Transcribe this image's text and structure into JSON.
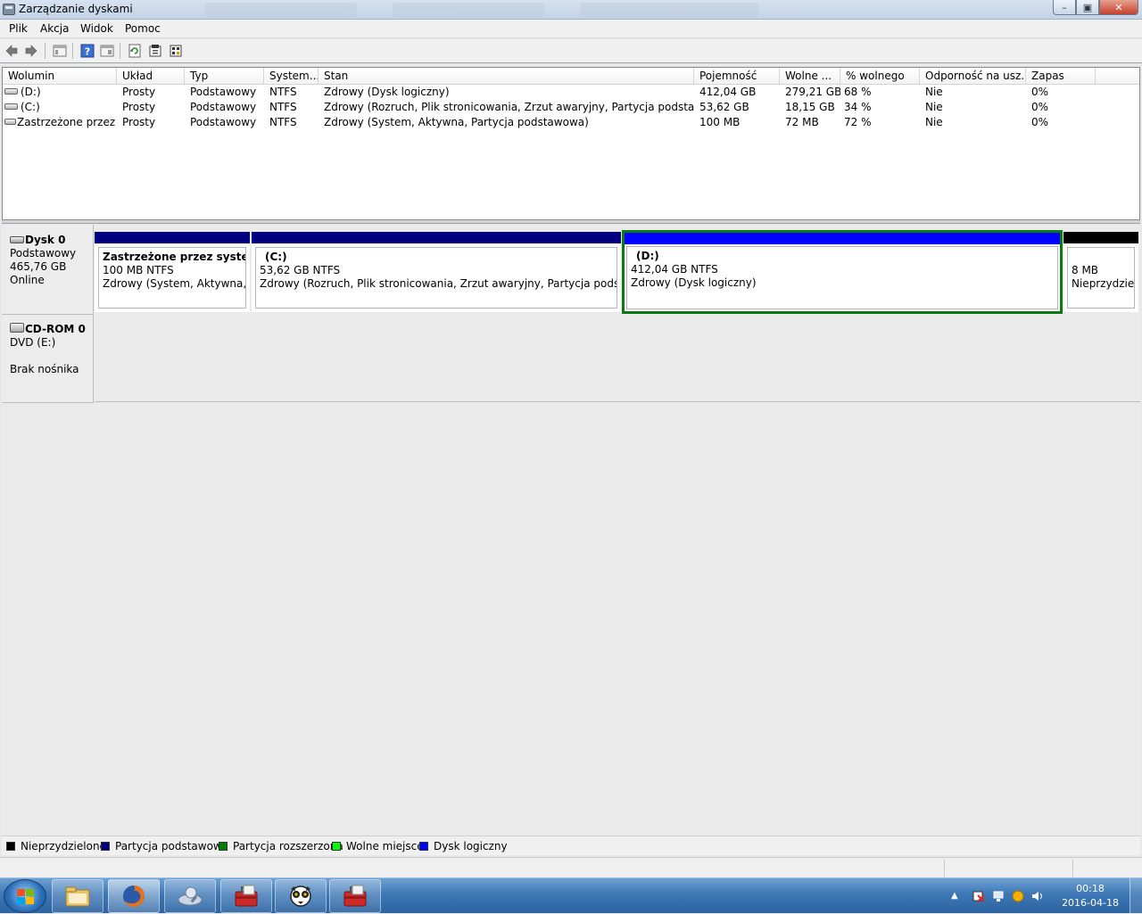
{
  "window": {
    "title": "Zarządzanie dyskami"
  },
  "menu": [
    "Plik",
    "Akcja",
    "Widok",
    "Pomoc"
  ],
  "toolbar": {
    "icons": [
      "back-arrow-icon",
      "forward-arrow-icon",
      "console-tree-icon",
      "help-icon",
      "properties-icon",
      "refresh-icon",
      "rescan-icon",
      "export-list-icon"
    ]
  },
  "volume_list": {
    "columns": [
      "Wolumin",
      "Układ",
      "Typ",
      "System...",
      "Stan",
      "Pojemność",
      "Wolne ...",
      "% wolnego",
      "Odporność na usz...",
      "Zapas"
    ],
    "rows": [
      [
        "(D:)",
        "Prosty",
        "Podstawowy",
        "NTFS",
        "Zdrowy (Dysk logiczny)",
        "412,04 GB",
        "279,21 GB",
        "68 %",
        "Nie",
        "0%"
      ],
      [
        "(C:)",
        "Prosty",
        "Podstawowy",
        "NTFS",
        "Zdrowy (Rozruch, Plik stronicowania, Zrzut awaryjny, Partycja podstawowa)",
        "53,62 GB",
        "18,15 GB",
        "34 %",
        "Nie",
        "0%"
      ],
      [
        "Zastrzeżone przez ...",
        "Prosty",
        "Podstawowy",
        "NTFS",
        "Zdrowy (System, Aktywna, Partycja podstawowa)",
        "100 MB",
        "72 MB",
        "72 %",
        "Nie",
        "0%"
      ]
    ]
  },
  "disks": {
    "disk0": {
      "name": "Dysk 0",
      "type": "Podstawowy",
      "size": "465,76 GB",
      "status": "Online",
      "partitions": [
        {
          "title": "Zastrzeżone przez system",
          "size": "100 MB NTFS",
          "status": "Zdrowy (System, Aktywna, Par",
          "bar_color": "#00007f"
        },
        {
          "title": "(C:)",
          "size": "53,62 GB NTFS",
          "status": "Zdrowy (Rozruch, Plik stronicowania, Zrzut awaryjny, Partycja podstawowa)",
          "bar_color": "#00007f"
        },
        {
          "title": "(D:)",
          "size": "412,04 GB NTFS",
          "status": "Zdrowy (Dysk logiczny)",
          "bar_color": "#0000ff"
        },
        {
          "title": "",
          "size": "8 MB",
          "status": "Nieprzydzielc",
          "bar_color": "#000000"
        }
      ]
    },
    "cdrom0": {
      "name": "CD-ROM 0",
      "drive": "DVD (E:)",
      "status": "Brak nośnika"
    }
  },
  "legend": [
    {
      "label": "Nieprzydzielone",
      "color": "#000000"
    },
    {
      "label": "Partycja podstawowa",
      "color": "#00007f"
    },
    {
      "label": "Partycja rozszerzona",
      "color": "#007f00"
    },
    {
      "label": "Wolne miejsce",
      "color": "#00ff00"
    },
    {
      "label": "Dysk logiczny",
      "color": "#0000ff"
    }
  ],
  "taskbar": {
    "apps": [
      "explorer-icon",
      "firefox-icon",
      "disk-cleanup-icon",
      "toolbox-icon",
      "lemur-icon",
      "toolbox-icon"
    ],
    "clock_time": "00:18",
    "clock_date": "2016-04-18"
  },
  "colors": {
    "selection_border": "#0b7a12"
  }
}
